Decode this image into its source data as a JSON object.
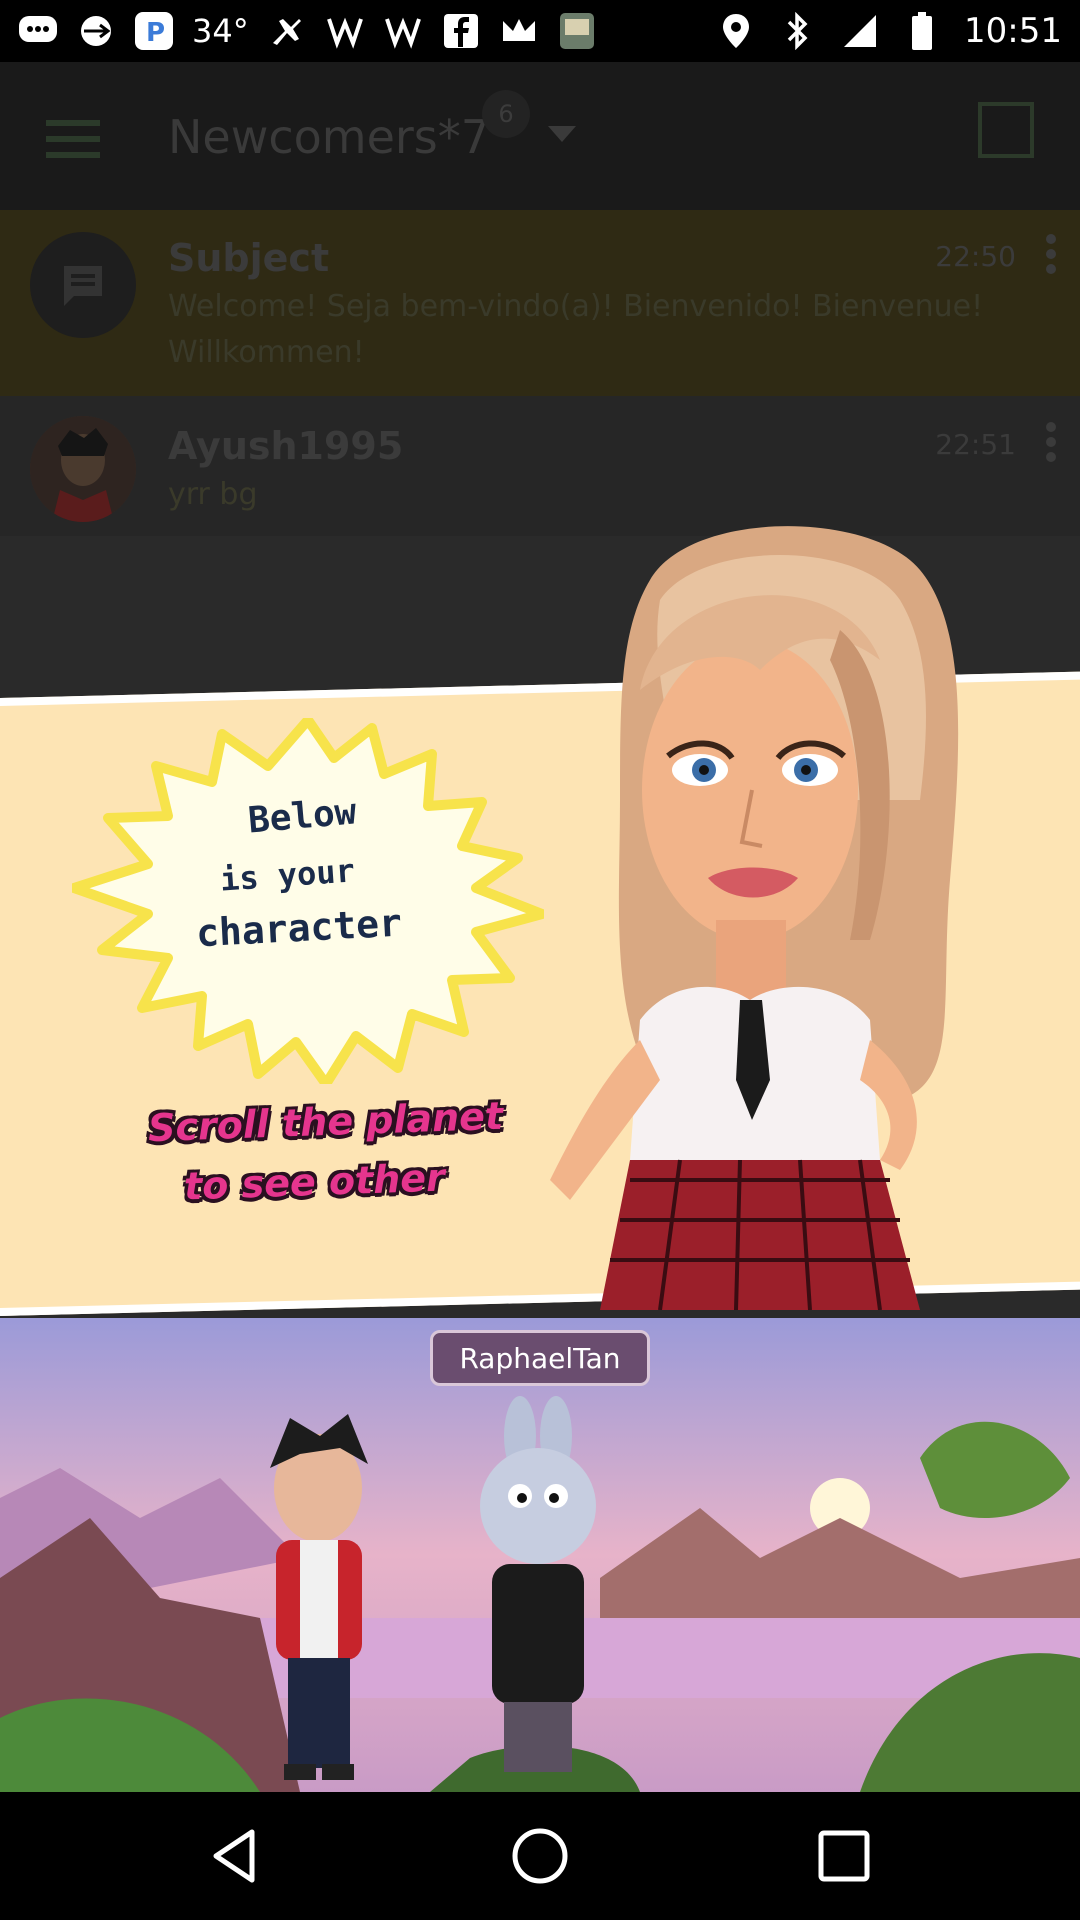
{
  "status_bar": {
    "temperature": "34°",
    "time": "10:51",
    "icons": [
      "chat-bubble-icon",
      "usb-icon",
      "p-app-icon",
      "plane-icon",
      "wifi-like-icon",
      "wifi-like-icon",
      "facebook-icon",
      "crown-icon",
      "bible-icon",
      "location-icon",
      "bluetooth-icon",
      "signal-icon",
      "battery-icon"
    ]
  },
  "app_bar": {
    "title": "Newcomers*7",
    "badge_count": "6"
  },
  "messages": [
    {
      "name": "Subject",
      "body": "Welcome! Seja bem-vindo(a)! Bienvenido! Bienvenue! Willkommen!",
      "time": "22:50"
    },
    {
      "name": "Ayush1995",
      "body": "yrr bg",
      "time": "22:51"
    }
  ],
  "tutorial": {
    "line1": "Below",
    "line2": "is your",
    "line3": "character",
    "hint1": "Scroll the planet",
    "hint2": "to see other"
  },
  "scene": {
    "character_name": "RaphaelTan"
  },
  "colors": {
    "panel": "#fde4b4",
    "hint_pink": "#e5358e",
    "name_pill": "#6a4d6f"
  }
}
